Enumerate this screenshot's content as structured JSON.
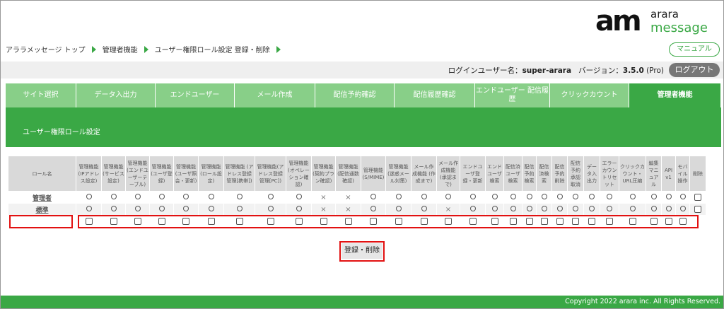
{
  "brand": {
    "logo_am": "am",
    "logo_arara": "arara",
    "logo_message": "message",
    "accent": "#3aa845"
  },
  "breadcrumb": [
    "アララメッセージ トップ",
    "管理者機能",
    "ユーザー権限ロール設定 登録・削除"
  ],
  "manual_label": "マニュアル",
  "login": {
    "user_label": "ログインユーザー名：",
    "user_name": "super-arara",
    "version_label": "バージョン：",
    "version": "3.5.0",
    "edition": "(Pro)"
  },
  "logout_label": "ログアウト",
  "tabs": [
    {
      "label": "サイト選択",
      "active": false
    },
    {
      "label": "データ入出力",
      "active": false
    },
    {
      "label": "エンドユーザー",
      "active": false
    },
    {
      "label": "メール作成",
      "active": false
    },
    {
      "label": "配信予約確認",
      "active": false
    },
    {
      "label": "配信履歴確認",
      "active": false
    },
    {
      "label": "エンドユーザー 配信履歴",
      "active": false
    },
    {
      "label": "クリックカウント",
      "active": false
    },
    {
      "label": "管理者機能",
      "active": true
    }
  ],
  "section_title": "ユーザー権限ロール設定",
  "table": {
    "role_header": "ロール名",
    "columns": [
      "管理機能 (IPアドレス設定)",
      "管理機能(サービス設定)",
      "管理機能 (エンドユーザーテーブル)",
      "管理機能(ユーザ登録)",
      "管理機能 (ユーザ照会・更新)",
      "管理機能(ロール設定)",
      "管理機能 (アドレス登録管理[携帯])",
      "管理機能(アドレス登録管理[PC])",
      "管理機能 (オペレーション確認)",
      "管理機能(契約プラン確認)",
      "管理機能(配信通数確認)",
      "管理機能 (S/MIME)",
      "管理機能(迷惑メール対策)",
      "メール作成機能 (作成まで)",
      "メール作成機能(承認まで)",
      "エンドユーザ登録・更新",
      "エンドユーザ検索",
      "配信済ユーザ検索",
      "配信予約検索",
      "配信済検索",
      "配信予約削除",
      "配信予約承認取消",
      "データ入出力",
      "エラーカウントリセット",
      "クリックカウント・URL圧縮",
      "編集マニュアル",
      "API v1",
      "モバイル操作",
      "削除"
    ],
    "rows": [
      {
        "name": "管理者",
        "cells": [
          "○",
          "○",
          "○",
          "○",
          "○",
          "○",
          "○",
          "○",
          "○",
          "×",
          "×",
          "○",
          "○",
          "○",
          "○",
          "○",
          "○",
          "○",
          "○",
          "○",
          "○",
          "○",
          "○",
          "○",
          "○",
          "○",
          "○",
          "○",
          "□"
        ]
      },
      {
        "name": "標準",
        "cells": [
          "○",
          "○",
          "○",
          "○",
          "○",
          "○",
          "○",
          "○",
          "○",
          "×",
          "×",
          "○",
          "○",
          "○",
          "×",
          "○",
          "○",
          "○",
          "○",
          "○",
          "○",
          "○",
          "○",
          "○",
          "○",
          "○",
          "○",
          "○",
          "□"
        ]
      },
      {
        "name": "",
        "cells": [
          "□",
          "□",
          "□",
          "□",
          "□",
          "□",
          "□",
          "□",
          "□",
          "□",
          "□",
          "□",
          "□",
          "□",
          "□",
          "□",
          "□",
          "□",
          "□",
          "□",
          "□",
          "□",
          "□",
          "□",
          "□",
          "□",
          "□",
          "□",
          ""
        ]
      }
    ]
  },
  "submit_label": "登録・削除",
  "copyright": "Copyright 2022 arara inc. All Rights Reserved."
}
